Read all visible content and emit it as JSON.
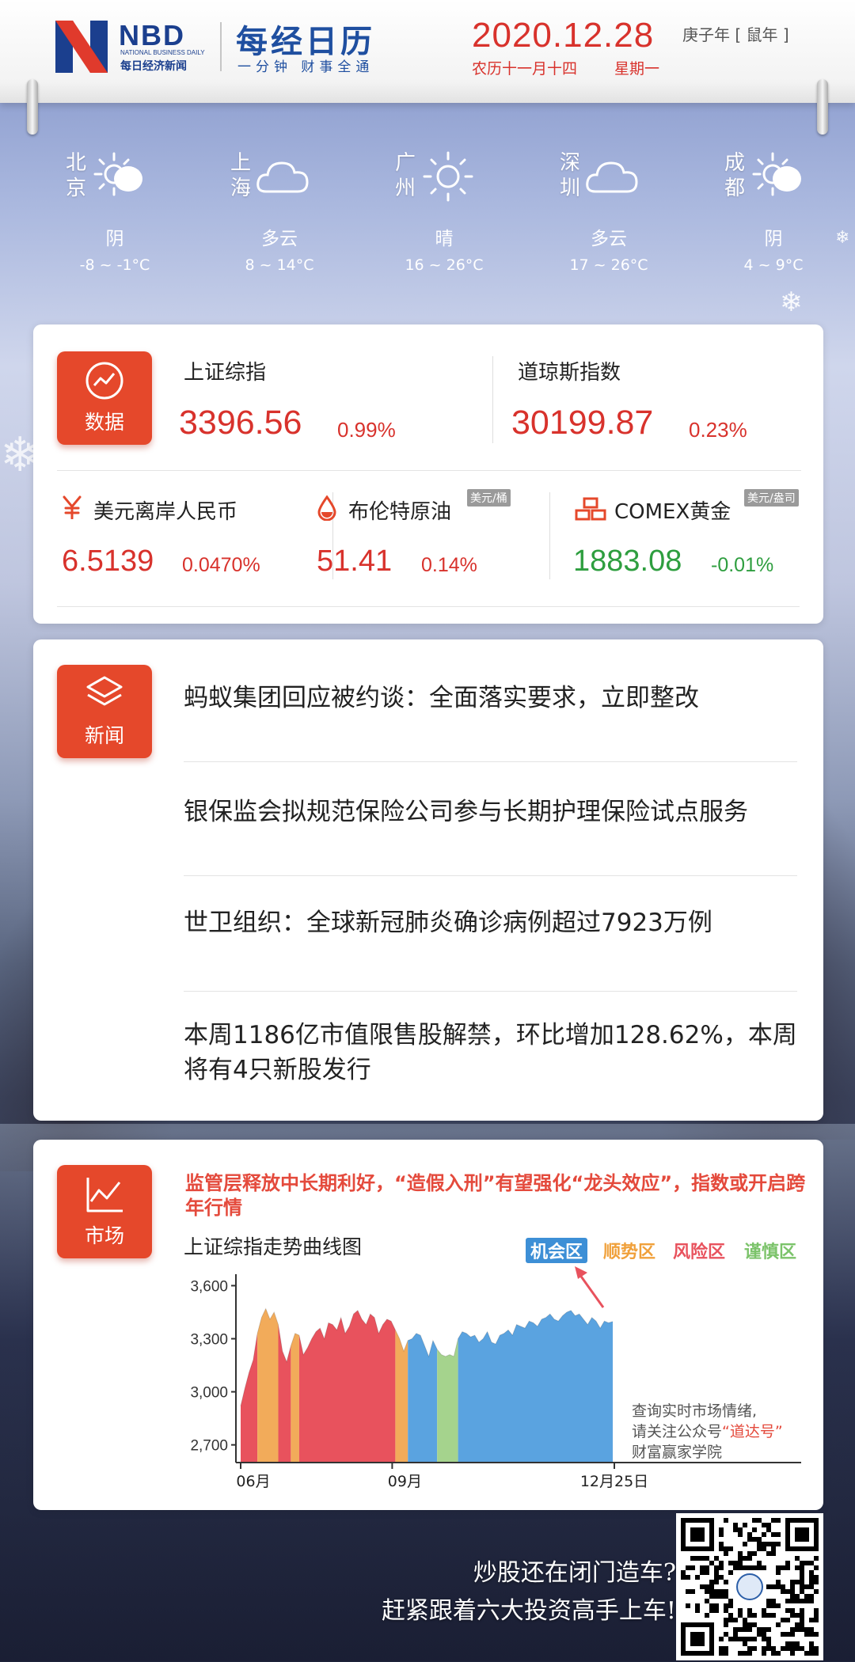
{
  "header": {
    "logo_nbd": "NBD",
    "logo_en": "NATIONAL BUSINESS DAILY",
    "logo_cn": "每日经济新闻",
    "calendar_title": "每经日历",
    "calendar_slogan": "一分钟 财事全通",
    "date": "2020.12.28",
    "lunar_date": "农历十一月十四",
    "weekday": "星期一",
    "zodiac_year": "庚子年 [ 鼠年 ]"
  },
  "weather": [
    {
      "city": "北京",
      "icon": "sun-behind-cloud-icon",
      "desc": "阴",
      "temp": "-8 ~ -1°C"
    },
    {
      "city": "上海",
      "icon": "cloud-icon",
      "desc": "多云",
      "temp": "8 ~ 14°C"
    },
    {
      "city": "广州",
      "icon": "sun-icon",
      "desc": "晴",
      "temp": "16 ~ 26°C"
    },
    {
      "city": "深圳",
      "icon": "cloud-icon",
      "desc": "多云",
      "temp": "17 ~ 26°C"
    },
    {
      "city": "成都",
      "icon": "sun-behind-cloud-icon",
      "desc": "阴",
      "temp": "4 ~ 9°C"
    }
  ],
  "data_card": {
    "badge_label": "数据",
    "sh_index": {
      "name": "上证综指",
      "value": "3396.56",
      "pct": "0.99%"
    },
    "dow": {
      "name": "道琼斯指数",
      "value": "30199.87",
      "pct": "0.23%"
    },
    "usdcnh": {
      "name": "美元离岸人民币",
      "value": "6.5139",
      "pct": "0.0470%"
    },
    "brent": {
      "name": "布伦特原油",
      "unit": "美元/桶",
      "value": "51.41",
      "pct": "0.14%"
    },
    "gold": {
      "name": "COMEX黄金",
      "unit": "美元/盎司",
      "value": "1883.08",
      "pct": "-0.01%"
    },
    "colors": {
      "up": "#d8322c",
      "down": "#2e9e3f",
      "accent": "#e5482b"
    }
  },
  "news_card": {
    "badge_label": "新闻",
    "items": [
      "蚂蚁集团回应被约谈：全面落实要求，立即整改",
      "银保监会拟规范保险公司参与长期护理保险试点服务",
      "世卫组织：全球新冠肺炎确诊病例超过7923万例",
      "本周1186亿市值限售股解禁，环比增加128.62%，本周将有4只新股发行"
    ]
  },
  "market_card": {
    "badge_label": "市场",
    "headline": "监管层释放中长期利好，“造假入刑”有望强化“龙头效应”，指数或开启跨年行情",
    "chart_title": "上证综指走势曲线图",
    "legend": [
      "机会区",
      "顺势区",
      "风险区",
      "谨慎区"
    ],
    "note_line1": "查询实时市场情绪,",
    "note_line2_prefix": "请关注公众号",
    "note_line2_highlight": "“道达号”",
    "note_line3": "财富赢家学院"
  },
  "chart_data": {
    "type": "area",
    "title": "上证综指走势曲线图",
    "y_ticks": [
      "3,600",
      "3,300",
      "3,000",
      "2,700"
    ],
    "x_ticks": [
      "06月",
      "09月",
      "12月25日"
    ],
    "ylim": [
      2600,
      3620
    ],
    "grid": false,
    "legend_position": "top-right",
    "zones": [
      {
        "name": "风险区",
        "color": "#e8525d"
      },
      {
        "name": "顺势区",
        "color": "#f2ab5a"
      },
      {
        "name": "谨慎区",
        "color": "#a5d38d"
      },
      {
        "name": "机会区",
        "color": "#5aa3e0"
      }
    ],
    "series": [
      {
        "values": [
          2920,
          3020,
          3110,
          3180,
          3330,
          3420,
          3470,
          3410,
          3450,
          3380,
          3230,
          3170,
          3260,
          3330,
          3320,
          3210,
          3250,
          3300,
          3340,
          3360,
          3300,
          3390,
          3380,
          3350,
          3420,
          3330,
          3370,
          3440,
          3460,
          3410,
          3380,
          3440,
          3420,
          3330,
          3380,
          3410,
          3400,
          3350,
          3300,
          3230,
          3290,
          3300,
          3330,
          3320,
          3260,
          3200,
          3290,
          3240,
          3210,
          3200,
          3210,
          3200,
          3300,
          3340,
          3330,
          3310,
          3320,
          3280,
          3300,
          3340,
          3280,
          3270,
          3320,
          3330,
          3350,
          3320,
          3380,
          3370,
          3360,
          3400,
          3390,
          3370,
          3410,
          3420,
          3440,
          3410,
          3400,
          3430,
          3450,
          3460,
          3430,
          3440,
          3410,
          3380,
          3420,
          3400,
          3360,
          3400,
          3390,
          3397
        ]
      },
      {
        "zone_sequence": [
          "风险区",
          "顺势区",
          "风险区",
          "顺势区",
          "风险区",
          "顺势区",
          "机会区",
          "谨慎区",
          "机会区"
        ]
      }
    ]
  }
}
